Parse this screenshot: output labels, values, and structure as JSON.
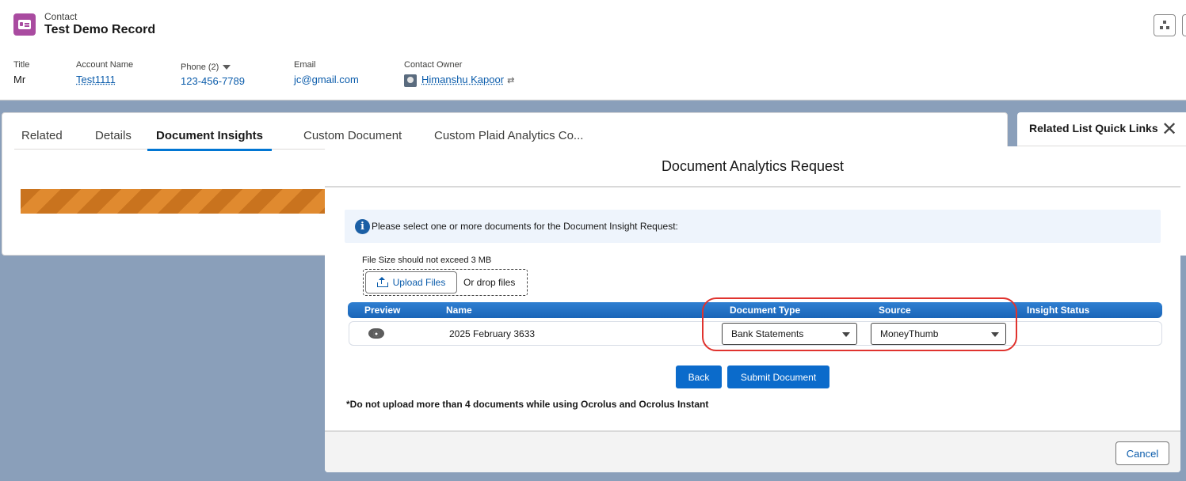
{
  "record": {
    "object": "Contact",
    "title": "Test Demo Record",
    "fields": {
      "title": {
        "label": "Title",
        "value": "Mr"
      },
      "account": {
        "label": "Account Name",
        "value": "Test1111"
      },
      "phone": {
        "label": "Phone (2)",
        "value": "123-456-7789"
      },
      "email": {
        "label": "Email",
        "value": "jc@gmail.com"
      },
      "owner": {
        "label": "Contact Owner",
        "value": "Himanshu Kapoor"
      }
    }
  },
  "tabs": [
    "Related",
    "Details",
    "Document Insights",
    "Custom Document",
    "Custom Plaid Analytics Co..."
  ],
  "active_tab": "Document Insights",
  "right_panel": {
    "title": "Related List Quick Links"
  },
  "modal": {
    "title": "Document Analytics Request",
    "info": "Please select one or more documents for the Document Insight Request:",
    "file_size_note": "File Size should not exceed 3 MB",
    "upload_label": "Upload Files",
    "drop_label": "Or drop files",
    "table": {
      "headers": [
        "Preview",
        "Name",
        "Document Type",
        "Source",
        "Insight Status"
      ],
      "rows": [
        {
          "name": "2025 February 3633",
          "document_type": "Bank Statements",
          "source": "MoneyThumb",
          "insight_status": ""
        }
      ]
    },
    "back_label": "Back",
    "submit_label": "Submit Document",
    "note": "*Do not upload more than 4 documents while using Ocrolus and Ocrolus Instant",
    "cancel_label": "Cancel",
    "close_symbol": "✕"
  },
  "colors": {
    "brand": "#0176d3",
    "button": "#0b6bcb",
    "highlight": "#e0332e",
    "contact_icon": "#a94ba0"
  }
}
